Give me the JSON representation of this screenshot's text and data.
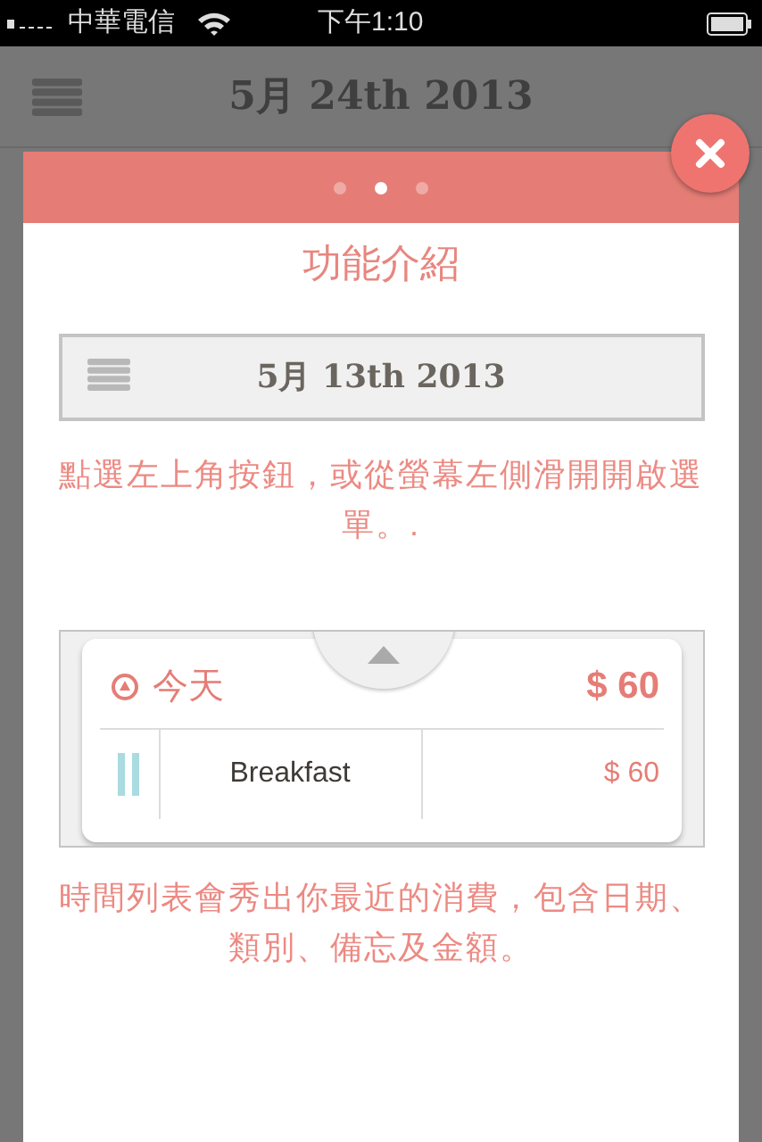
{
  "status_bar": {
    "carrier": "中華電信",
    "time": "下午1:10"
  },
  "header": {
    "title": "5月 24th 2013"
  },
  "modal": {
    "pager": [
      {
        "selected": false
      },
      {
        "selected": true
      },
      {
        "selected": false
      }
    ],
    "title": "功能介紹",
    "demo_header": {
      "title": "5月 13th 2013"
    },
    "description_1": "點選左上角按鈕，或從螢幕左側滑開開啟選單。.",
    "demo_card": {
      "day": "今天",
      "total": "$ 60",
      "entries": [
        {
          "note": "Breakfast",
          "amount": "$ 60"
        }
      ]
    },
    "description_2": "時間列表會秀出你最近的消費，包含日期、類別、備忘及金額。"
  }
}
